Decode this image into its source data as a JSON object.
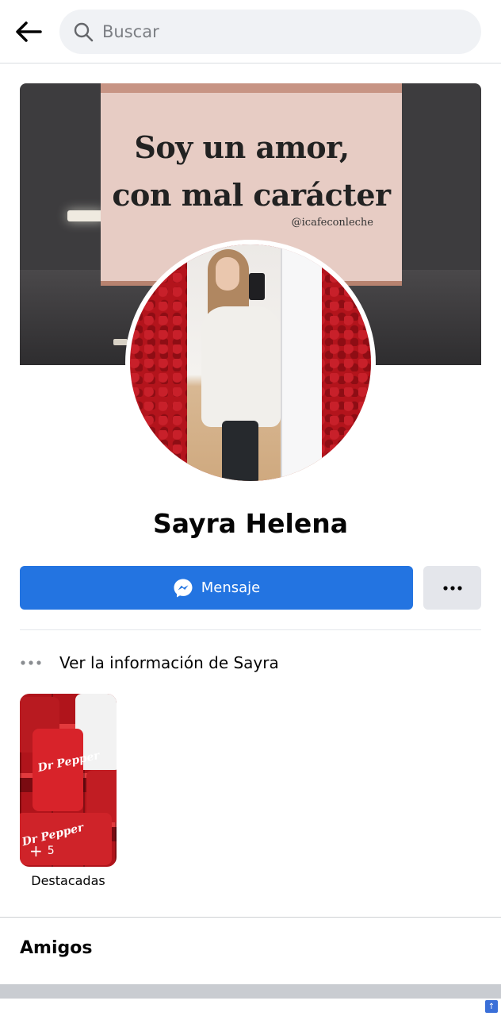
{
  "header": {
    "search_placeholder": "Buscar",
    "icons": [
      "back-arrow-icon",
      "search-icon"
    ]
  },
  "cover": {
    "sign_line1": "Soy un amor,",
    "sign_line2": "con mal carácter",
    "sign_handle": "@icafeconleche"
  },
  "profile": {
    "name": "Sayra Helena"
  },
  "actions": {
    "message_label": "Mensaje",
    "more_icon": "more-horizontal-icon"
  },
  "info": {
    "label": "Ver la información de Sayra"
  },
  "featured": {
    "count": "5",
    "caption": "Destacadas"
  },
  "friends": {
    "title": "Amigos"
  },
  "colors": {
    "primary": "#2374e1",
    "secondary_button": "#e4e6eb",
    "search_bg": "#f0f2f5",
    "text": "#050505"
  }
}
